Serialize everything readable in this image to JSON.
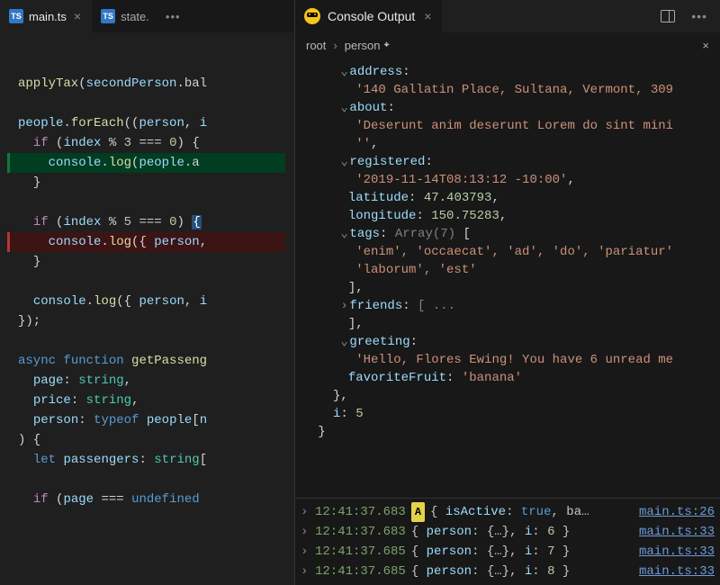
{
  "editor": {
    "tabs": [
      {
        "icon": "TS",
        "label": "main.ts",
        "active": true
      },
      {
        "icon": "TS",
        "label": "state.",
        "active": false
      }
    ],
    "code": {
      "l1": {
        "fn": "applyTax",
        "arg_obj": "secondPerson",
        "arg_prop": ".bal"
      },
      "l2": {
        "obj": "people",
        "method": "forEach",
        "params": "(person, i"
      },
      "l3": {
        "kw": "if",
        "cond": "(index % 3 === 0) {"
      },
      "l4": {
        "obj": "console",
        "method": "log",
        "arg_obj": "people",
        "arg_suffix": ".a"
      },
      "l5": "}",
      "l6": {
        "kw": "if",
        "cond": "(index % 5 === 0)"
      },
      "l7": {
        "obj": "console",
        "method": "log",
        "args": "({ person,"
      },
      "l8": "}",
      "l9": {
        "obj": "console",
        "method": "log",
        "args": "({ person, i"
      },
      "l10": "});",
      "fn_kw_async": "async",
      "fn_kw_function": "function",
      "fn_name": "getPasseng",
      "p1_name": "page",
      "p1_type": "string",
      "p2_name": "price",
      "p2_type": "string",
      "p3_name": "person",
      "p3_type_kw": "typeof",
      "p3_type_expr": "people[n",
      "bodyopen": ") {",
      "let_kw": "let",
      "let_name": "passengers",
      "let_type": "string[",
      "if_kw": "if",
      "if_cond_var": "page",
      "if_cond_op": "===",
      "if_cond_val": "undefined"
    }
  },
  "console": {
    "title": "Console Output",
    "breadcrumb": {
      "root": "root",
      "leaf": "person"
    },
    "inspector": {
      "address_key": "address",
      "address_val": "'140 Gallatin Place, Sultana, Vermont, 309",
      "about_key": "about",
      "about_val": "'Deserunt anim deserunt Lorem do sint mini",
      "about_close": "''",
      "registered_key": "registered",
      "registered_val": "'2019-11-14T08:13:12 -10:00'",
      "latitude_key": "latitude",
      "latitude_val": "47.403793",
      "longitude_key": "longitude",
      "longitude_val": "150.75283",
      "tags_key": "tags",
      "tags_type": "Array(7)",
      "tags_line1": "'enim', 'occaecat', 'ad', 'do', 'pariatur'",
      "tags_line2": "'laborum', 'est'",
      "friends_key": "friends",
      "friends_preview": "[ ...",
      "greeting_key": "greeting",
      "greeting_val": "'Hello, Flores Ewing! You have 6 unread me",
      "favfruit_key": "favoriteFruit",
      "favfruit_val": "'banana'",
      "outer_i_key": "i",
      "outer_i_val": "5"
    },
    "logs": [
      {
        "time": "12:41:37.683",
        "badge": "A",
        "preview": "{ isActive: true, ba…",
        "src": "main.ts:26"
      },
      {
        "time": "12:41:37.683",
        "preview": "{ person: {...}, i: 6 }",
        "src": "main.ts:33"
      },
      {
        "time": "12:41:37.685",
        "preview": "{ person: {...}, i: 7 }",
        "src": "main.ts:33"
      },
      {
        "time": "12:41:37.685",
        "preview": "{ person: {...}, i: 8 }",
        "src": "main.ts:33"
      }
    ]
  }
}
